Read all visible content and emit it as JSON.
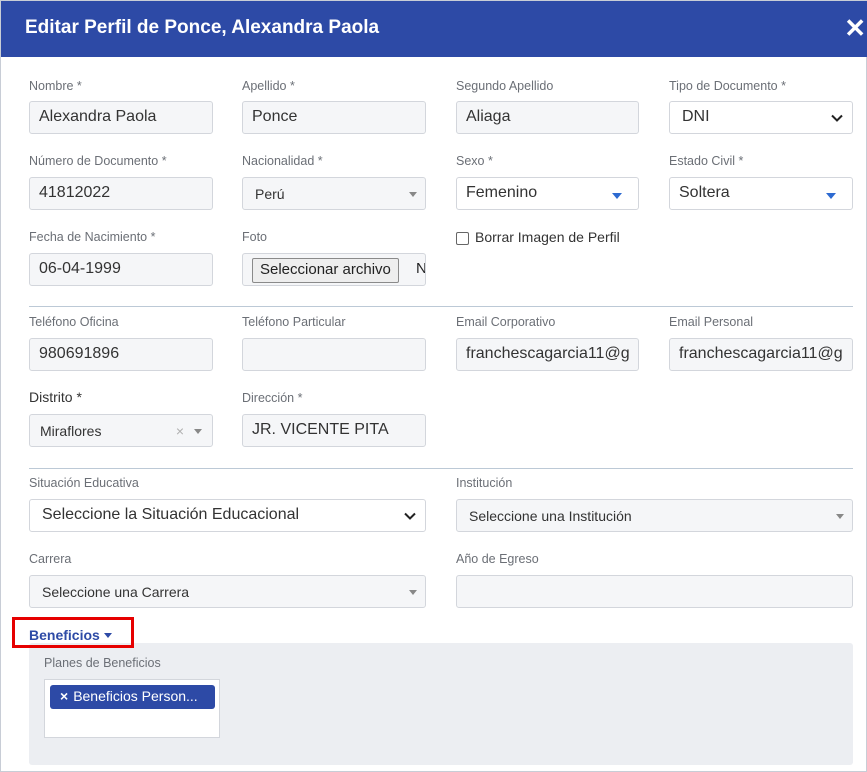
{
  "header": {
    "title": "Editar Perfil de Ponce, Alexandra Paola",
    "close_icon": "close-icon"
  },
  "fields": {
    "nombre": {
      "label": "Nombre *",
      "value": "Alexandra Paola"
    },
    "apellido": {
      "label": "Apellido *",
      "value": "Ponce"
    },
    "segundo_apellido": {
      "label": "Segundo Apellido",
      "value": "Aliaga"
    },
    "tipo_documento": {
      "label": "Tipo de Documento *",
      "value": "DNI"
    },
    "numero_documento": {
      "label": "Número de Documento *",
      "value": "41812022"
    },
    "nacionalidad": {
      "label": "Nacionalidad *",
      "value": "Perú"
    },
    "sexo": {
      "label": "Sexo *",
      "value": "Femenino"
    },
    "estado_civil": {
      "label": "Estado Civil *",
      "value": "Soltera"
    },
    "fecha_nacimiento": {
      "label": "Fecha de Nacimiento *",
      "value": "06-04-1999"
    },
    "foto": {
      "label": "Foto",
      "button": "Seleccionar archivo",
      "rest": "N"
    },
    "borrar_imagen": {
      "label": "Borrar Imagen de Perfil",
      "checked": false
    },
    "telefono_oficina": {
      "label": "Teléfono Oficina",
      "value": "980691896"
    },
    "telefono_particular": {
      "label": "Teléfono Particular",
      "value": ""
    },
    "email_corporativo": {
      "label": "Email Corporativo",
      "value": "franchescagarcia11@g"
    },
    "email_personal": {
      "label": "Email Personal",
      "value": "franchescagarcia11@g"
    },
    "distrito": {
      "label": "Distrito *",
      "value": "Miraflores",
      "clear": "×"
    },
    "direccion": {
      "label": "Dirección *",
      "value": "JR. VICENTE PITA"
    },
    "situacion_educativa": {
      "label": "Situación Educativa",
      "value": "Seleccione la Situación Educacional"
    },
    "institucion": {
      "label": "Institución",
      "value": "Seleccione una Institución"
    },
    "carrera": {
      "label": "Carrera",
      "value": "Seleccione una Carrera"
    },
    "anio_egreso": {
      "label": "Año de Egreso",
      "value": ""
    }
  },
  "beneficios": {
    "toggle": "Beneficios",
    "planes_label": "Planes de Beneficios",
    "tag_remove": "×",
    "tag": "Beneficios Person..."
  },
  "colors": {
    "header": "#2d4aa6",
    "highlight": "#e60000",
    "accent_caret": "#2d6ad1"
  }
}
